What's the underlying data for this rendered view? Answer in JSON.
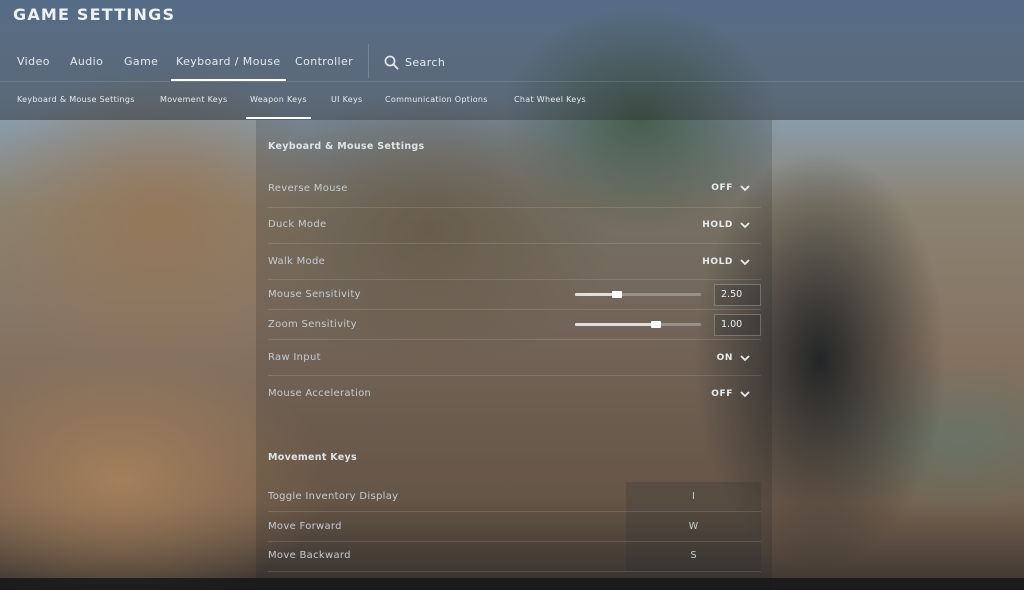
{
  "header": {
    "title": "GAME SETTINGS"
  },
  "tabs": [
    {
      "label": "Video",
      "active": false
    },
    {
      "label": "Audio",
      "active": false
    },
    {
      "label": "Game",
      "active": false
    },
    {
      "label": "Keyboard / Mouse",
      "active": true
    },
    {
      "label": "Controller",
      "active": false
    }
  ],
  "search": {
    "label": "Search",
    "icon": "search-icon"
  },
  "subtabs": [
    {
      "label": "Keyboard & Mouse Settings",
      "active": false
    },
    {
      "label": "Movement Keys",
      "active": false
    },
    {
      "label": "Weapon Keys",
      "active": true
    },
    {
      "label": "UI Keys",
      "active": false
    },
    {
      "label": "Communication Options",
      "active": false
    },
    {
      "label": "Chat Wheel Keys",
      "active": false
    }
  ],
  "keyboard_mouse": {
    "title": "Keyboard & Mouse Settings",
    "reverse_mouse": {
      "label": "Reverse Mouse",
      "value": "OFF"
    },
    "duck_mode": {
      "label": "Duck Mode",
      "value": "HOLD"
    },
    "walk_mode": {
      "label": "Walk Mode",
      "value": "HOLD"
    },
    "mouse_sensitivity": {
      "label": "Mouse Sensitivity",
      "value": "2.50",
      "fraction": 0.33
    },
    "zoom_sensitivity": {
      "label": "Zoom Sensitivity",
      "value": "1.00",
      "fraction": 0.64
    },
    "raw_input": {
      "label": "Raw Input",
      "value": "ON"
    },
    "mouse_acceleration": {
      "label": "Mouse Acceleration",
      "value": "OFF"
    }
  },
  "movement_keys": {
    "title": "Movement Keys",
    "toggle_inventory": {
      "label": "Toggle Inventory Display",
      "key": "I"
    },
    "move_forward": {
      "label": "Move Forward",
      "key": "W"
    },
    "move_backward": {
      "label": "Move Backward",
      "key": "S"
    }
  },
  "icons": {
    "dropdown": "chevron-down-icon"
  }
}
